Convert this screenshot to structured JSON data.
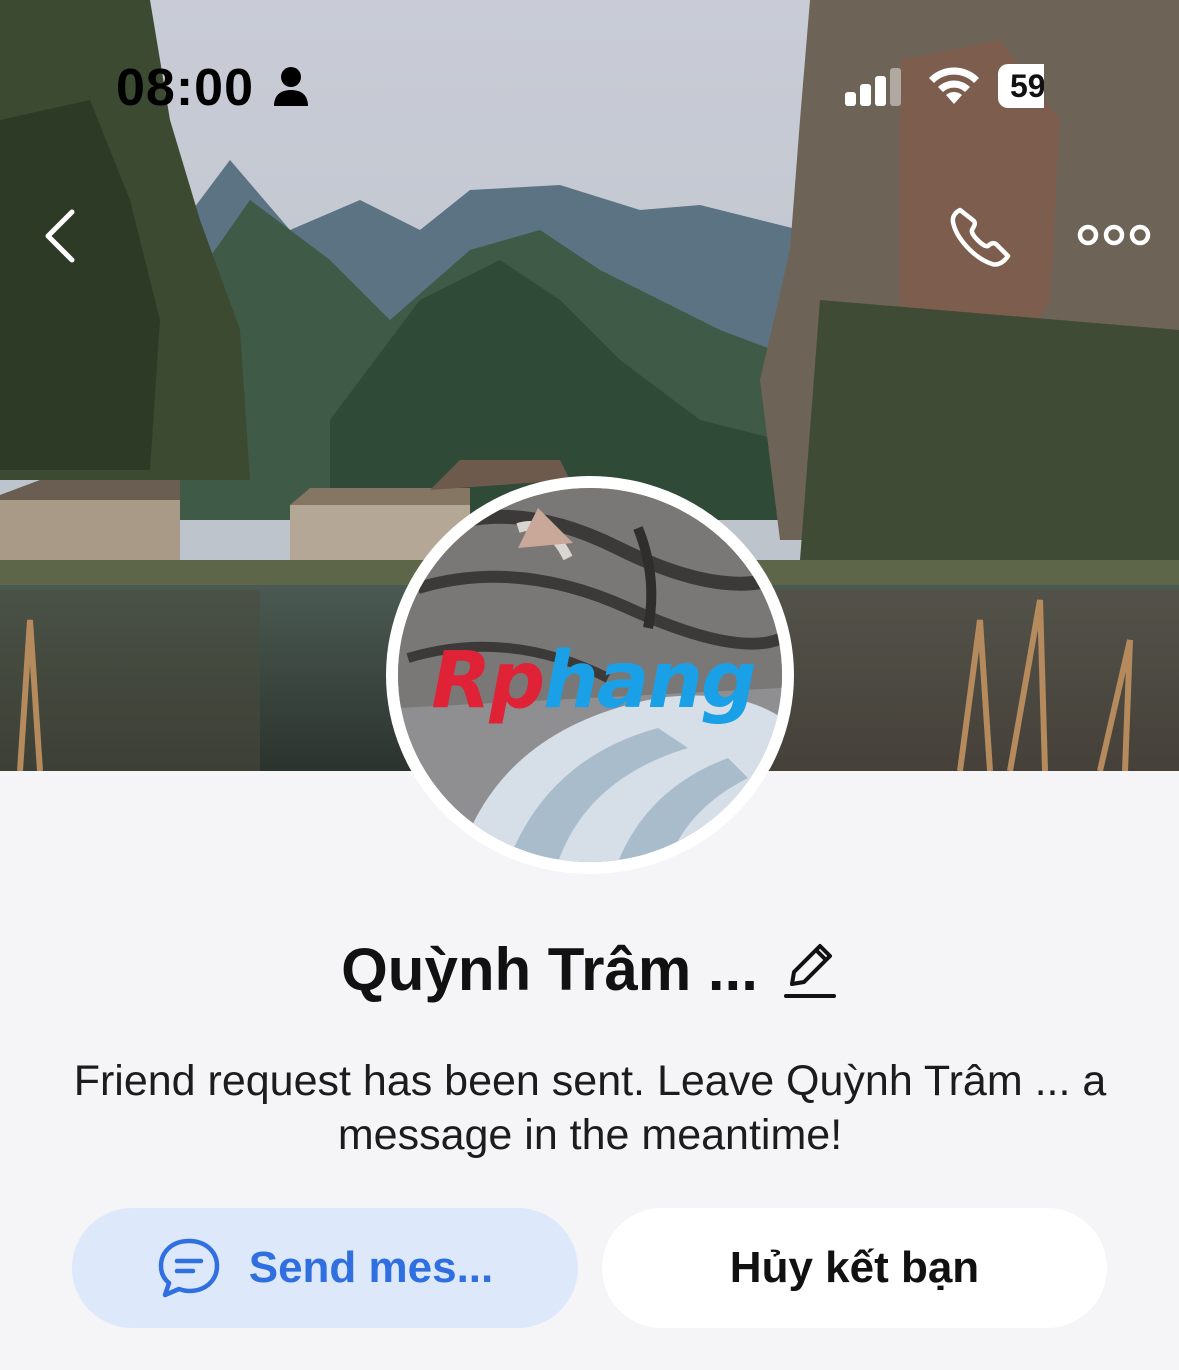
{
  "status_bar": {
    "time": "08:00",
    "battery": "59"
  },
  "icons": {
    "back": "chevron-left-icon",
    "call": "phone-icon",
    "more": "more-horizontal-icon",
    "edit": "pencil-icon",
    "message": "chat-bubble-icon"
  },
  "profile": {
    "name": "Quỳnh Trâm ...",
    "avatar_watermark_part1": "Rp",
    "avatar_watermark_part2": "hang",
    "status_message": "Friend request has been sent. Leave Quỳnh Trâm ... a message in the meantime!"
  },
  "actions": {
    "send_message_label": "Send mes...",
    "unfriend_label": "Hủy kết bạn"
  },
  "colors": {
    "primary": "#2f6fe0",
    "send_bg": "#dde8fb",
    "page_bg": "#f5f5f7"
  }
}
